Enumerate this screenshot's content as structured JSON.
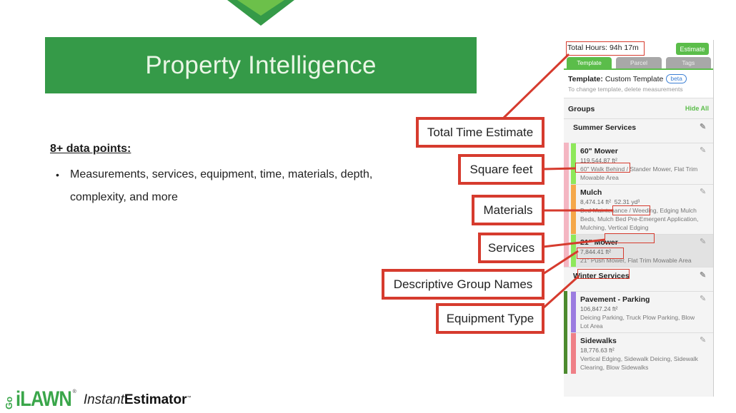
{
  "slide": {
    "title": "Property Intelligence",
    "heading": "8+ data points:",
    "bullets": [
      "Measurements, services, equipment, time, materials, depth, complexity, and more"
    ],
    "colors": {
      "banner": "#359a48",
      "accent": "#5bbd4a",
      "callout": "#d63b2e"
    }
  },
  "logo": {
    "go": "Go",
    "ilawn": "iLAWN",
    "registered": "®",
    "instant": "Instant",
    "estimator": "Estimator",
    "tm": "™"
  },
  "callouts": [
    {
      "id": "total-time",
      "label": "Total Time Estimate"
    },
    {
      "id": "square-feet",
      "label": "Square feet"
    },
    {
      "id": "materials",
      "label": "Materials"
    },
    {
      "id": "services",
      "label": "Services"
    },
    {
      "id": "group-names",
      "label": "Descriptive Group Names"
    },
    {
      "id": "equipment",
      "label": "Equipment Type"
    }
  ],
  "panel": {
    "total_hours": "Total Hours: 94h 17m",
    "estimate_label": "Estimate",
    "tabs": [
      {
        "label": "Template",
        "active": true
      },
      {
        "label": "Parcel",
        "active": false
      },
      {
        "label": "Tags",
        "active": false
      }
    ],
    "template_label": "Template:",
    "template_value": "Custom Template",
    "beta_label": "beta",
    "template_hint": "To change template, delete measurements",
    "groups_label": "Groups",
    "hide_all_label": "Hide All",
    "groups": [
      {
        "name": "Summer Services",
        "color": "#f4b6c2",
        "items": [
          {
            "name": "60\" Mower",
            "area": "119,544.87 ft²",
            "desc": "60\" Walk Behind / Stander Mower, Flat Trim Mowable Area",
            "color": "#8ee85a",
            "selected": false
          },
          {
            "name": "Mulch",
            "area": "8,474.14 ft²",
            "volume": "52.31 yd³",
            "desc": "Bed Maintenance / Weeding, Edging Mulch Beds, Mulch Bed Pre-Emergent Application, Mulching, Vertical Edging",
            "color": "#f5a84a",
            "selected": false
          },
          {
            "name": "21\" Mower",
            "area": "7,844.41 ft²",
            "desc": "21\" Push Mower, Flat Trim Mowable Area",
            "color": "#8ee85a",
            "selected": true
          }
        ]
      },
      {
        "name": "Winter Services",
        "color": "#4c8a2e",
        "items": [
          {
            "name": "Pavement - Parking",
            "area": "106,847.24 ft²",
            "desc": "Deicing Parking, Truck Plow Parking, Blow Lot Area",
            "color": "#9b7be0",
            "selected": false
          },
          {
            "name": "Sidewalks",
            "area": "18,776.63 ft²",
            "desc": "Vertical Edging, Sidewalk Deicing, Sidewalk Clearing, Blow Sidewalks",
            "color": "#ef7f86",
            "selected": false
          }
        ]
      }
    ]
  }
}
